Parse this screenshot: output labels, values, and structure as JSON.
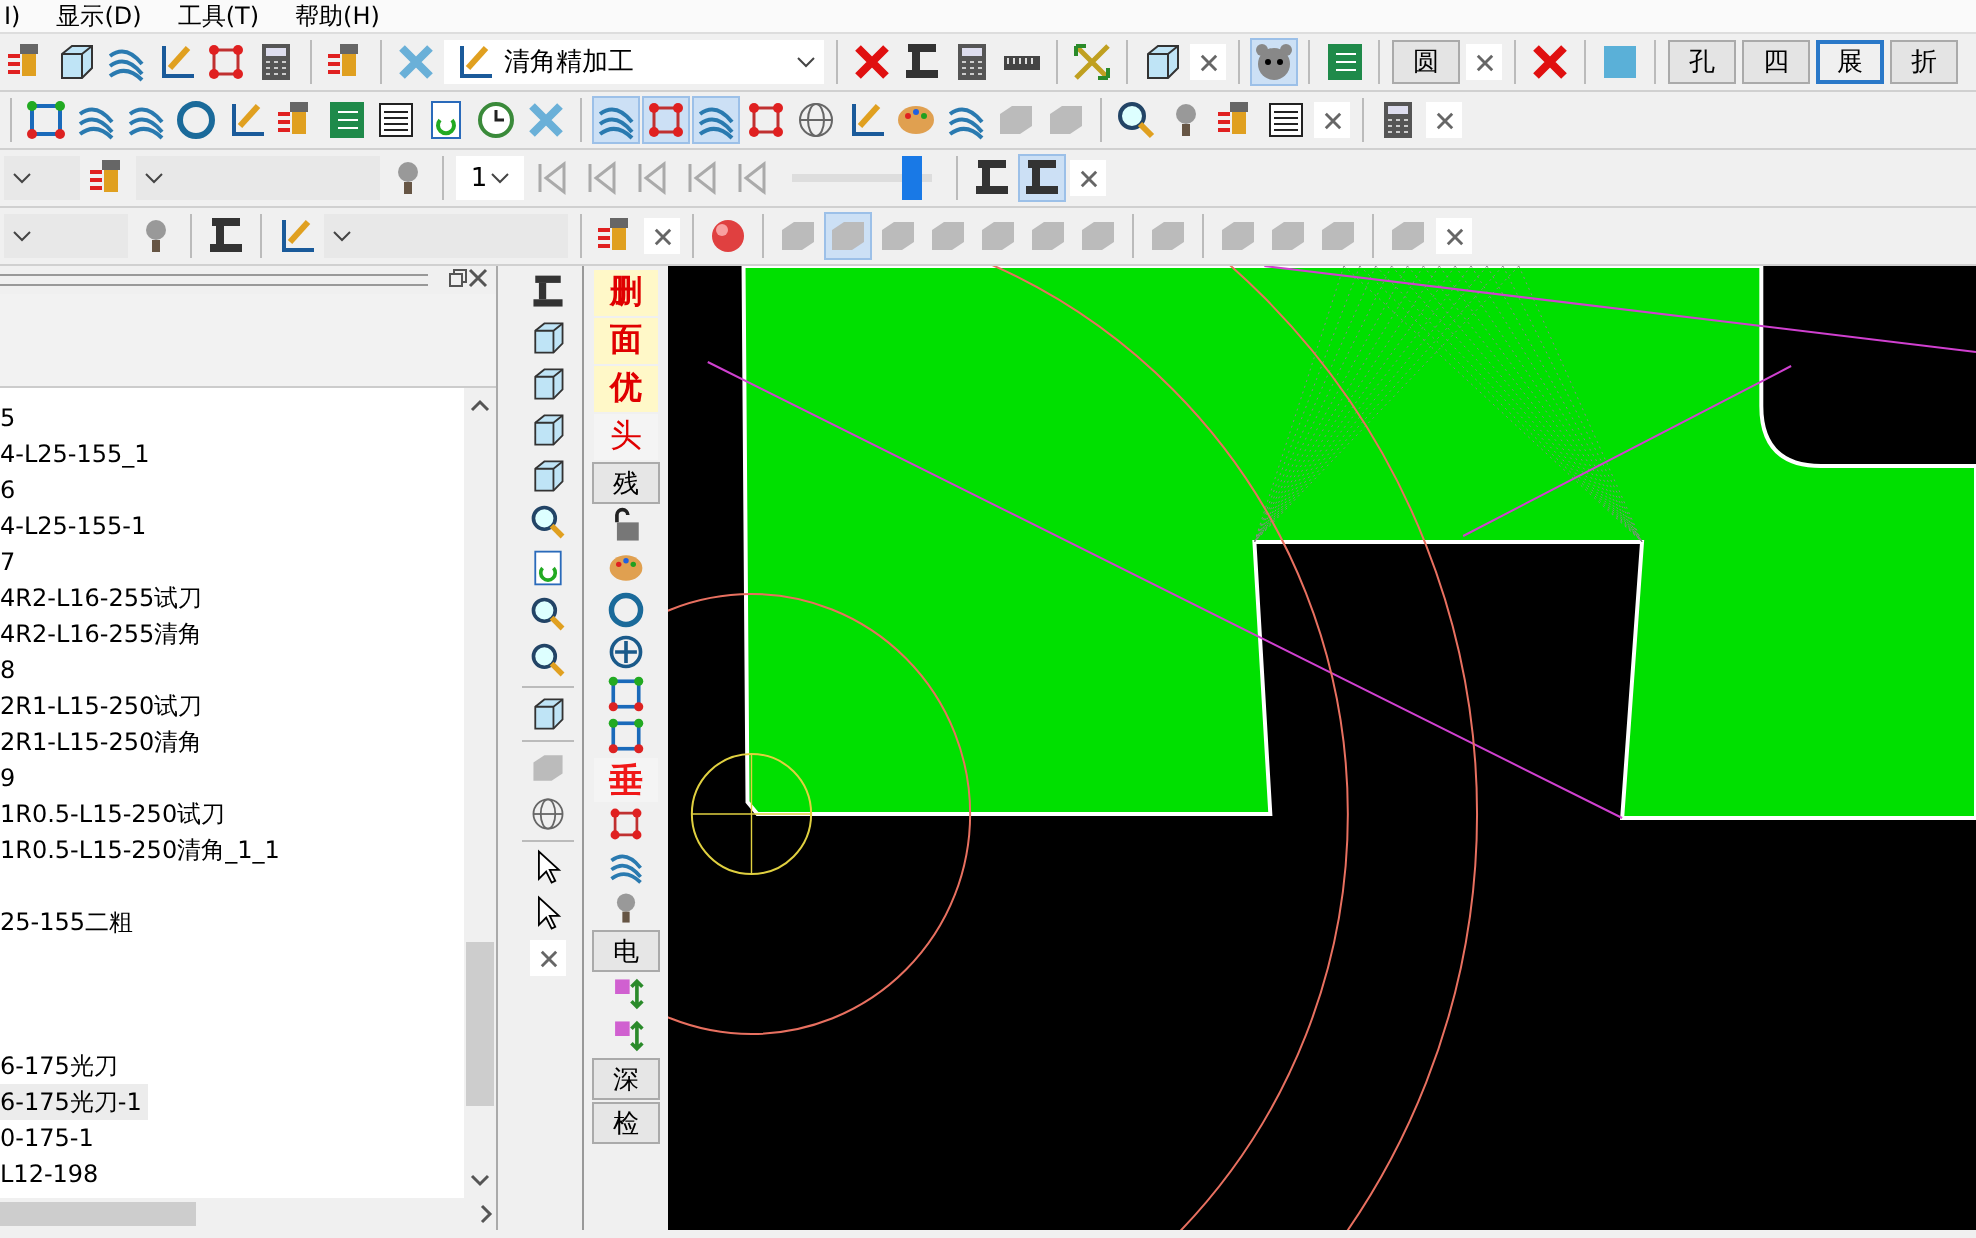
{
  "menu": [
    {
      "label": "I)"
    },
    {
      "label": "显示(D)"
    },
    {
      "label": "工具(T)"
    },
    {
      "label": "帮助(H)"
    }
  ],
  "operation_dropdown": {
    "value": "清角精加工"
  },
  "shape_buttons": [
    {
      "label": "圆",
      "selected": false
    }
  ],
  "mode_buttons": [
    {
      "label": "孔",
      "selected": false
    },
    {
      "label": "四",
      "selected": false
    },
    {
      "label": "展",
      "selected": true
    },
    {
      "label": "折",
      "selected": false
    }
  ],
  "playback": {
    "frame": "1",
    "slider": {
      "level": 0.93
    }
  },
  "tree": {
    "items": [
      {
        "kind": "item",
        "text": "5",
        "selected": false
      },
      {
        "kind": "item",
        "text": "4-L25-155_1",
        "selected": false
      },
      {
        "kind": "item",
        "text": "6",
        "selected": false
      },
      {
        "kind": "item",
        "text": "4-L25-155-1",
        "selected": false
      },
      {
        "kind": "item",
        "text": "7",
        "selected": false
      },
      {
        "kind": "item",
        "text": "4R2-L16-255试刀",
        "selected": false
      },
      {
        "kind": "item",
        "text": "4R2-L16-255清角",
        "selected": false
      },
      {
        "kind": "item",
        "text": "8",
        "selected": false
      },
      {
        "kind": "item",
        "text": "2R1-L15-250试刀",
        "selected": false
      },
      {
        "kind": "item",
        "text": "2R1-L15-250清角",
        "selected": false
      },
      {
        "kind": "item",
        "text": "9",
        "selected": false
      },
      {
        "kind": "item",
        "text": "1R0.5-L15-250试刀",
        "selected": false
      },
      {
        "kind": "item",
        "text": "1R0.5-L15-250清角_1_1",
        "selected": false
      },
      {
        "kind": "spacer"
      },
      {
        "kind": "item",
        "text": "25-155二粗",
        "selected": false
      },
      {
        "kind": "spacer"
      },
      {
        "kind": "spacer"
      },
      {
        "kind": "spacer"
      },
      {
        "kind": "item",
        "text": "6-175光刀",
        "selected": false
      },
      {
        "kind": "item",
        "text": "6-175光刀-1",
        "selected": true
      },
      {
        "kind": "item",
        "text": "0-175-1",
        "selected": false
      },
      {
        "kind": "item",
        "text": "L12-198",
        "selected": false
      }
    ]
  },
  "side_buttons": [
    {
      "label": "删",
      "kind": "highlight"
    },
    {
      "label": "面",
      "kind": "highlight"
    },
    {
      "label": "优",
      "kind": "highlight"
    },
    {
      "label": "头",
      "kind": "red"
    },
    {
      "label": "残",
      "kind": "plain"
    },
    {
      "label": "垂",
      "kind": "red-large"
    },
    {
      "label": "电",
      "kind": "plain"
    },
    {
      "label": "深",
      "kind": "plain"
    },
    {
      "label": "检",
      "kind": "plain"
    }
  ]
}
